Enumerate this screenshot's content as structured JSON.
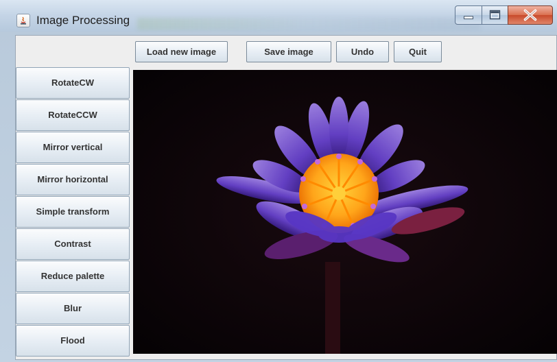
{
  "window": {
    "title": "Image Processing",
    "controls": {
      "minimize": "minimize-icon",
      "maximize": "maximize-icon",
      "close": "close-icon"
    }
  },
  "toolbar": {
    "load_label": "Load new image",
    "save_label": "Save image",
    "undo_label": "Undo",
    "quit_label": "Quit"
  },
  "sidebar": {
    "items": [
      {
        "label": "RotateCW"
      },
      {
        "label": "RotateCCW"
      },
      {
        "label": "Mirror vertical"
      },
      {
        "label": "Mirror horizontal"
      },
      {
        "label": "Simple transform"
      },
      {
        "label": "Contrast"
      },
      {
        "label": "Reduce palette"
      },
      {
        "label": "Blur"
      },
      {
        "label": "Flood"
      }
    ]
  },
  "image": {
    "subject": "purple water lily on black background",
    "colors": {
      "background": "#0a0508",
      "petal": "#6b45d6",
      "petal_light": "#9a7cf0",
      "center": "#ffb31a",
      "stamen": "#ff7a00"
    }
  }
}
